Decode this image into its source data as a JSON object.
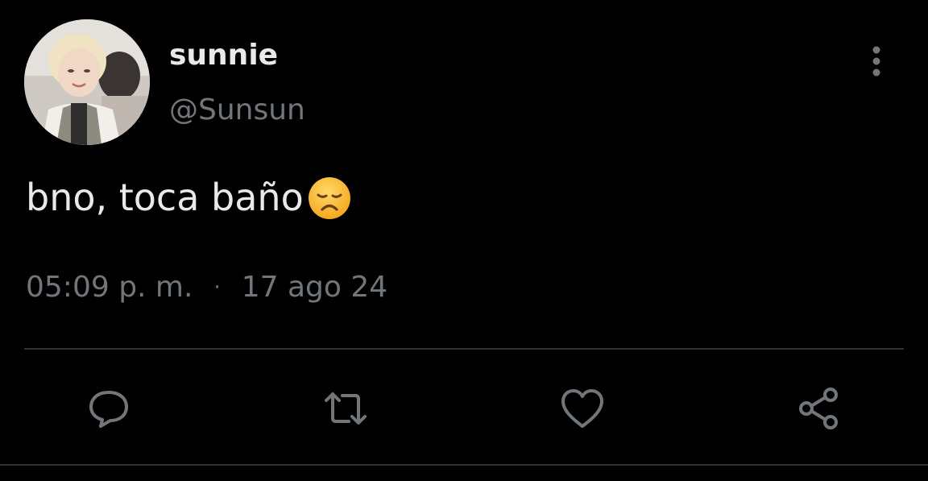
{
  "user": {
    "display_name": "sunnie",
    "handle": "@Sunsun",
    "avatar_icon": "avatar-photo"
  },
  "tweet": {
    "text": "bno, toca baño",
    "emoji": "disappointed-face-emoji"
  },
  "meta": {
    "time": "05:09 p. m.",
    "separator": "·",
    "date": "17 ago 24"
  },
  "actions": {
    "reply_icon": "reply-icon",
    "retweet_icon": "retweet-icon",
    "like_icon": "heart-icon",
    "share_icon": "share-icon"
  },
  "colors": {
    "background": "#000000",
    "primary_text": "#e7e9ea",
    "secondary_text": "#71767b",
    "divider": "#2f3336",
    "emoji_yellow": "#f6c343"
  }
}
